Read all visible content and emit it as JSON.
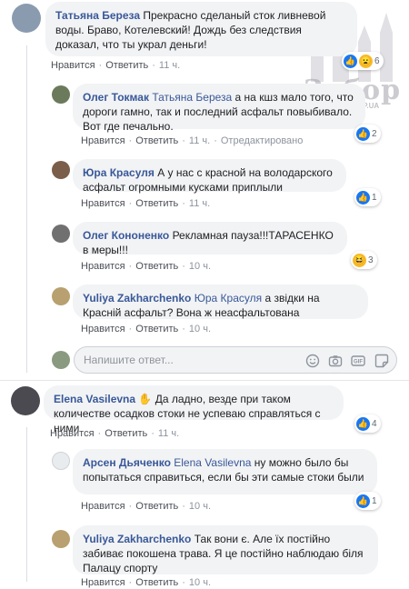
{
  "watermark": {
    "brand": "Забор",
    "domain": ".ZP.UA"
  },
  "comments": [
    {
      "author": "Татьяна Береза",
      "text": "Прекрасно сделаный сток ливневой воды. Браво, Котелевский! Дождь без следствия доказал, что ты украл деньги!",
      "like": "Нравится",
      "reply": "Ответить",
      "time": "11 ч.",
      "reactions": "6"
    },
    {
      "author": "Олег Токмак",
      "mention": "Татьяна Береза",
      "text": "а на кшз мало того, что дороги гамно, так и последний асфальт повыбивало. Вот где печально.",
      "like": "Нравится",
      "reply": "Ответить",
      "time": "11 ч.",
      "extra": "Отредактировано",
      "reactions": "2"
    },
    {
      "author": "Юра Красуля",
      "text": "А у нас с красной на володарского асфальт огромными кусками приплыли",
      "like": "Нравится",
      "reply": "Ответить",
      "time": "11 ч.",
      "reactions": "1"
    },
    {
      "author": "Олег Кононенко",
      "text": "Рекламная пауза!!!ТАРАСЕНКО в меры!!!",
      "like": "Нравится",
      "reply": "Ответить",
      "time": "10 ч.",
      "reactions": "3"
    },
    {
      "author": "Yuliya Zakharchenko",
      "mention": "Юра Красуля",
      "text": "а звідки на Красній асфальт? Вона ж неасфальтована",
      "like": "Нравится",
      "reply": "Ответить",
      "time": "10 ч."
    },
    {
      "author": "Elena Vasilevna",
      "text": "Да ладно, везде при таком количестве осадков стоки не успеваю справляться с ними",
      "like": "Нравится",
      "reply": "Ответить",
      "time": "11 ч.",
      "reactions": "4"
    },
    {
      "author": "Арсен Дьяченко",
      "mention": "Elena Vasilevna",
      "text": "ну можно было бы попытаться справиться, если бы эти самые стоки были",
      "like": "Нравится",
      "reply": "Ответить",
      "time": "10 ч.",
      "reactions": "1"
    },
    {
      "author": "Yuliya Zakharchenko",
      "text": "Так вони є. Але їх постійно забиває покошена трава. Я це постійно наблюдаю біля Палацу спорту",
      "like": "Нравится",
      "reply": "Ответить",
      "time": "10 ч."
    }
  ],
  "reply_box": {
    "placeholder": "Напишите ответ..."
  },
  "colors": {
    "link": "#385898",
    "like": "#1877f2",
    "bubble": "#f2f3f5"
  },
  "icons": [
    "emoji-icon",
    "camera-icon",
    "gif-icon",
    "sticker-icon",
    "like-reaction-icon",
    "haha-reaction-icon",
    "waving-hand-icon",
    "confounded-face-icon"
  ]
}
